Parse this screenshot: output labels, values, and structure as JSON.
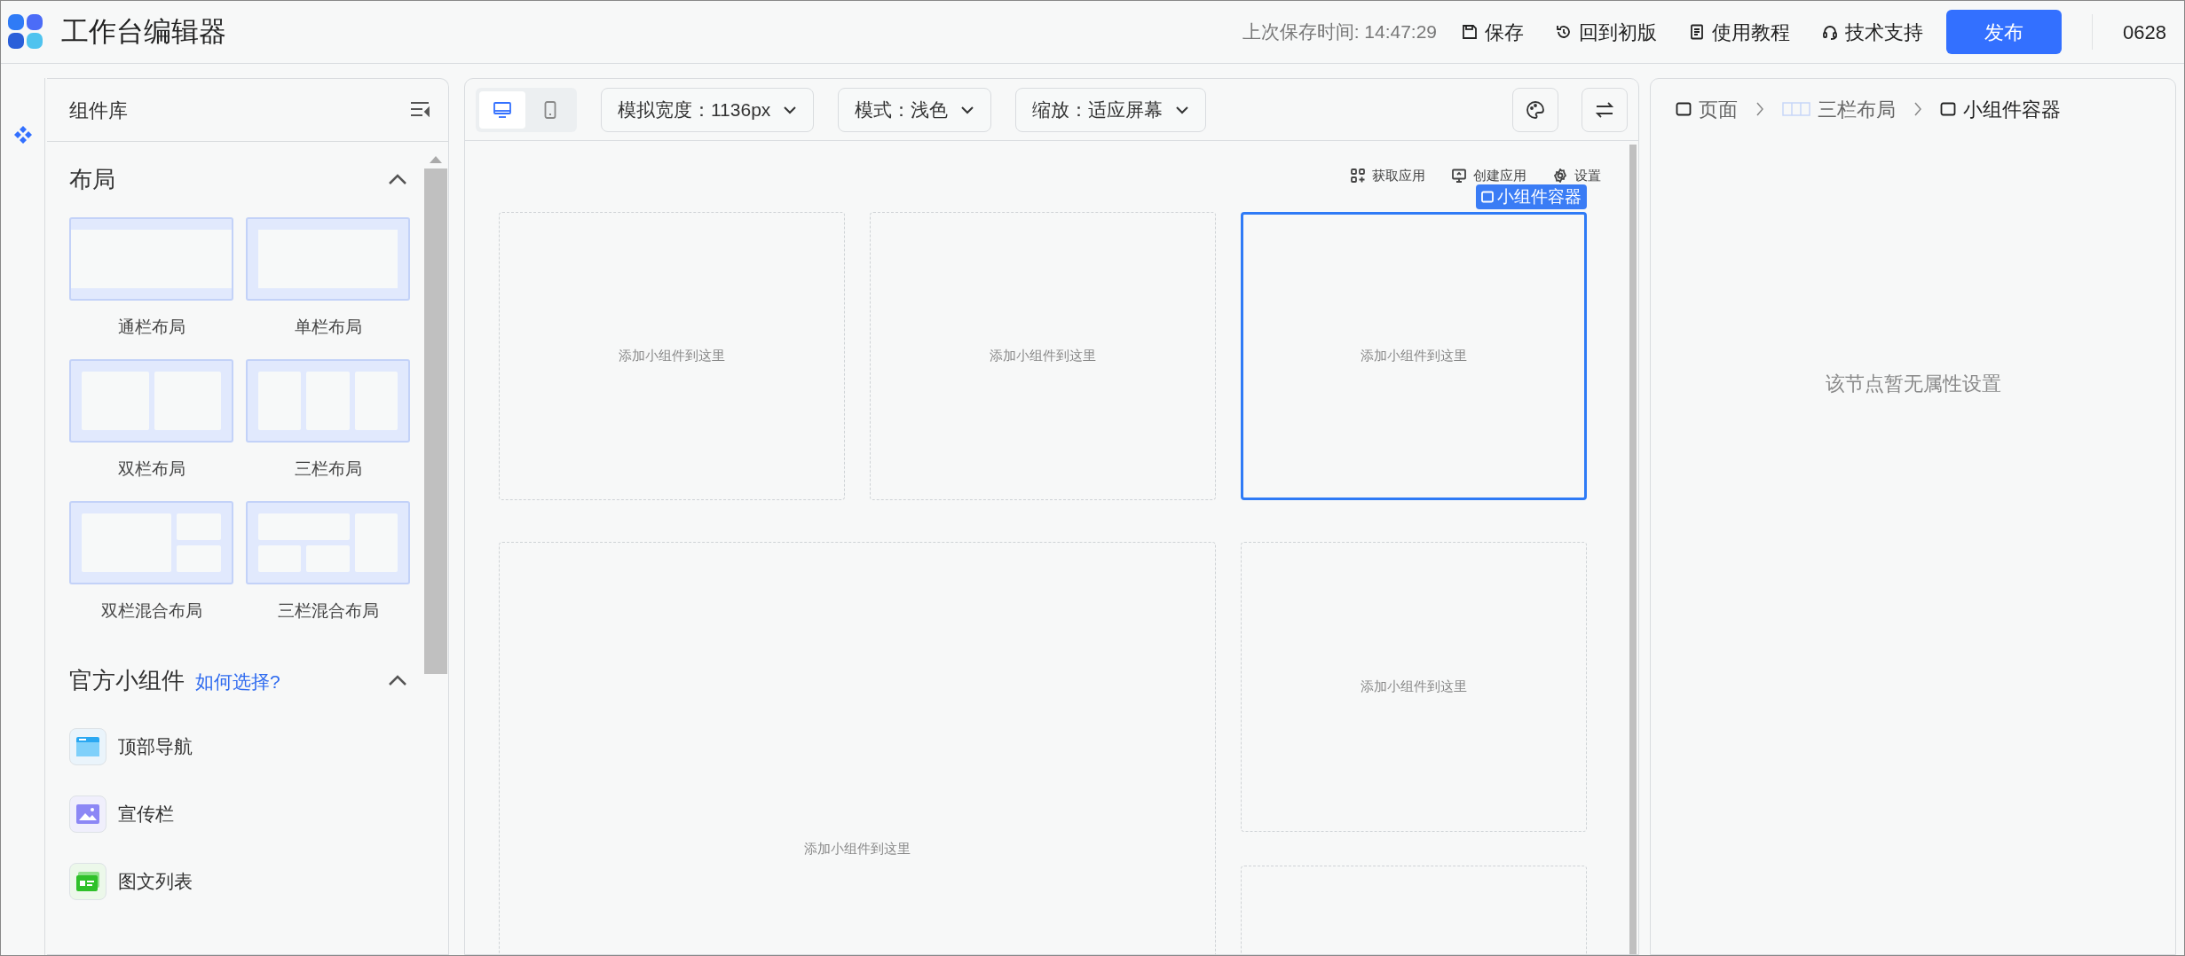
{
  "app": {
    "title": "工作台编辑器"
  },
  "header": {
    "save_time": "上次保存时间: 14:47:29",
    "publish": "发布",
    "user": "0628",
    "actions": [
      {
        "label": "保存",
        "kind": "save"
      },
      {
        "label": "回到初版",
        "kind": "revert"
      },
      {
        "label": "使用教程",
        "kind": "guide"
      },
      {
        "label": "技术支持",
        "kind": "support"
      }
    ]
  },
  "library": {
    "title": "组件库",
    "layout_section": {
      "title": "布局",
      "expanded": true,
      "layouts": [
        {
          "label": "通栏布局",
          "kind": "full"
        },
        {
          "label": "单栏布局",
          "kind": "single"
        },
        {
          "label": "双栏布局",
          "kind": "two"
        },
        {
          "label": "三栏布局",
          "kind": "three"
        },
        {
          "label": "双栏混合布局",
          "kind": "two-mixed"
        },
        {
          "label": "三栏混合布局",
          "kind": "three-mixed"
        }
      ]
    },
    "widget_section": {
      "title": "官方小组件",
      "link": "如何选择?",
      "expanded": true,
      "widgets": [
        {
          "label": "顶部导航",
          "kind": "nav"
        },
        {
          "label": "宣传栏",
          "kind": "banner"
        },
        {
          "label": "图文列表",
          "kind": "list"
        }
      ]
    }
  },
  "toolbar": {
    "devices": [
      {
        "kind": "desktop",
        "selected": true
      },
      {
        "kind": "mobile",
        "selected": false
      }
    ],
    "dropdowns": [
      "模拟宽度：1136px",
      "模式：浅色",
      "缩放：适应屏幕"
    ]
  },
  "canvas": {
    "links": [
      {
        "label": "获取应用",
        "kind": "apps"
      },
      {
        "label": "创建应用",
        "kind": "create"
      },
      {
        "label": "设置",
        "kind": "settings"
      }
    ],
    "selected_badge": "小组件容器",
    "row_1": [
      {
        "text": "添加小组件到这里",
        "selected": false
      },
      {
        "text": "添加小组件到这里",
        "selected": false
      },
      {
        "text": "添加小组件到这里",
        "selected": true
      }
    ],
    "row_2": {
      "main": {
        "text": "添加小组件到这里",
        "selected": false
      },
      "side": [
        {
          "text": "添加小组件到这里",
          "selected": false
        },
        {
          "selected": false
        }
      ]
    }
  },
  "properties": {
    "breadcrumb": [
      {
        "label": "页面",
        "kind": "page",
        "selected": false
      },
      {
        "label": "三栏布局",
        "kind": "layout",
        "selected": false
      },
      {
        "label": "小组件容器",
        "kind": "container",
        "selected": true
      }
    ],
    "empty_message": "该节点暂无属性设置"
  }
}
